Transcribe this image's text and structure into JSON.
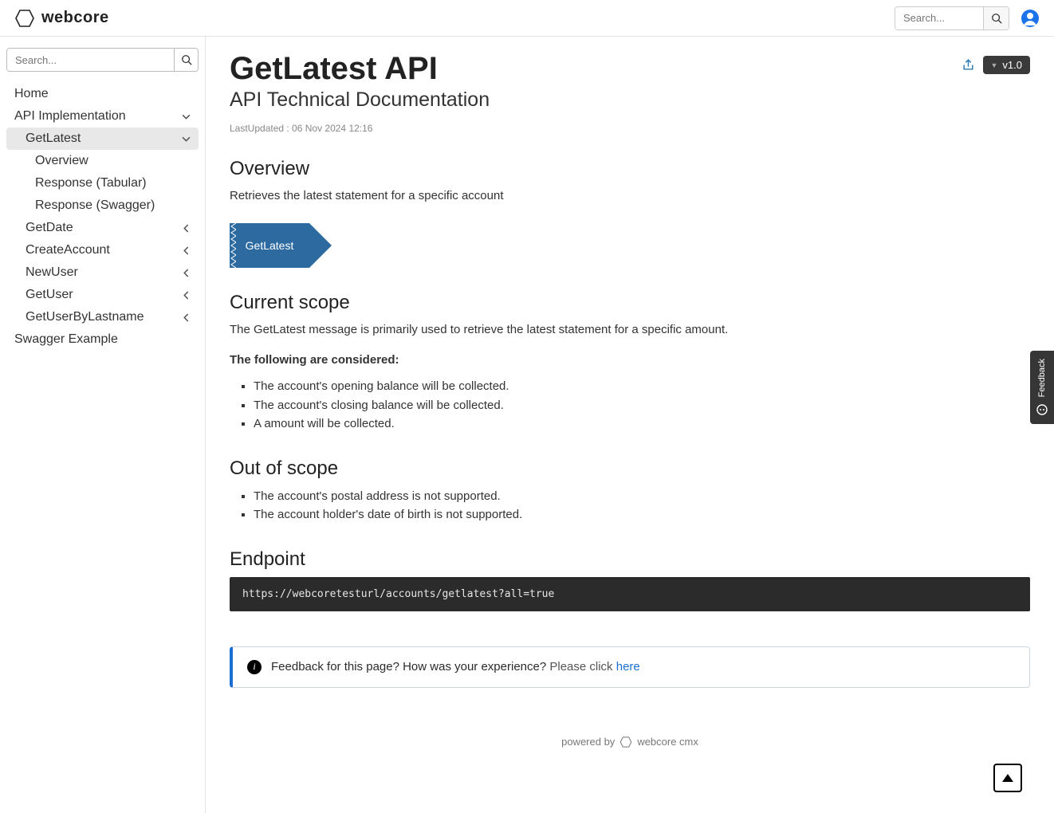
{
  "brand": {
    "name": "webcore"
  },
  "top": {
    "search_placeholder": "Search..."
  },
  "sidebar": {
    "search_placeholder": "Search...",
    "items": [
      {
        "label": "Home",
        "lvl": 0,
        "chev": ""
      },
      {
        "label": "API Implementation",
        "lvl": 0,
        "chev": "down"
      },
      {
        "label": "GetLatest",
        "lvl": 1,
        "chev": "down",
        "active": true
      },
      {
        "label": "Overview",
        "lvl": 2,
        "chev": ""
      },
      {
        "label": "Response (Tabular)",
        "lvl": 2,
        "chev": ""
      },
      {
        "label": "Response (Swagger)",
        "lvl": 2,
        "chev": ""
      },
      {
        "label": "GetDate",
        "lvl": 1,
        "chev": "left"
      },
      {
        "label": "CreateAccount",
        "lvl": 1,
        "chev": "left"
      },
      {
        "label": "NewUser",
        "lvl": 1,
        "chev": "left"
      },
      {
        "label": "GetUser",
        "lvl": 1,
        "chev": "left"
      },
      {
        "label": "GetUserByLastname",
        "lvl": 1,
        "chev": "left"
      },
      {
        "label": "Swagger Example",
        "lvl": 0,
        "chev": ""
      }
    ]
  },
  "page": {
    "title": "GetLatest API",
    "subtitle": "API Technical Documentation",
    "last_updated": "LastUpdated : 06 Nov 2024 12:16",
    "version": "v1.0"
  },
  "overview": {
    "heading": "Overview",
    "text": "Retrieves the latest statement for a specific account",
    "tag": "GetLatest"
  },
  "scope": {
    "heading": "Current scope",
    "text": "The GetLatest message is primarily used to retrieve the latest statement for a specific amount.",
    "list_intro": "The following are considered:",
    "items": [
      "The account's opening balance will be collected.",
      "The account's closing balance will be collected.",
      "A amount will be collected."
    ]
  },
  "out": {
    "heading": "Out of scope",
    "items": [
      "The account's postal address is not supported.",
      "The account holder's date of birth is not supported."
    ]
  },
  "endpoint": {
    "heading": "Endpoint",
    "code": "https://webcoretesturl/accounts/getlatest?all=true"
  },
  "feedback": {
    "prompt": "Feedback for this page? How was your experience? ",
    "pre_link": "Please click ",
    "link": "here"
  },
  "footer": {
    "text": "powered by",
    "brand": "webcore cmx"
  },
  "fb_tab": {
    "label": "Feedback"
  }
}
